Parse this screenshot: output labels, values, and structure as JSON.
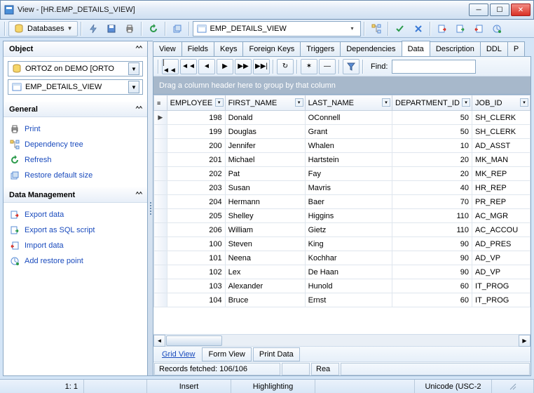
{
  "window": {
    "title": "View - [HR.EMP_DETAILS_VIEW]"
  },
  "toolbar": {
    "databases_label": "Databases",
    "breadcrumb": "EMP_DETAILS_VIEW"
  },
  "sidebar": {
    "object_header": "Object",
    "combo1": "ORTOZ on DEMO [ORTO",
    "combo2": "EMP_DETAILS_VIEW",
    "general_header": "General",
    "general_links": [
      "Print",
      "Dependency tree",
      "Refresh",
      "Restore default size"
    ],
    "datamgmt_header": "Data Management",
    "datamgmt_links": [
      "Export data",
      "Export as SQL script",
      "Import data",
      "Add restore point"
    ]
  },
  "tabs": [
    "View",
    "Fields",
    "Keys",
    "Foreign Keys",
    "Triggers",
    "Dependencies",
    "Data",
    "Description",
    "DDL",
    "P"
  ],
  "active_tab": "Data",
  "find_label": "Find:",
  "group_hint": "Drag a column header here to group by that column",
  "columns": [
    "EMPLOYEE",
    "FIRST_NAME",
    "LAST_NAME",
    "DEPARTMENT_ID",
    "JOB_ID"
  ],
  "rows": [
    {
      "emp": 198,
      "fn": "Donald",
      "ln": "OConnell",
      "dep": 50,
      "job": "SH_CLERK",
      "cur": true
    },
    {
      "emp": 199,
      "fn": "Douglas",
      "ln": "Grant",
      "dep": 50,
      "job": "SH_CLERK"
    },
    {
      "emp": 200,
      "fn": "Jennifer",
      "ln": "Whalen",
      "dep": 10,
      "job": "AD_ASST"
    },
    {
      "emp": 201,
      "fn": "Michael",
      "ln": "Hartstein",
      "dep": 20,
      "job": "MK_MAN"
    },
    {
      "emp": 202,
      "fn": "Pat",
      "ln": "Fay",
      "dep": 20,
      "job": "MK_REP"
    },
    {
      "emp": 203,
      "fn": "Susan",
      "ln": "Mavris",
      "dep": 40,
      "job": "HR_REP"
    },
    {
      "emp": 204,
      "fn": "Hermann",
      "ln": "Baer",
      "dep": 70,
      "job": "PR_REP"
    },
    {
      "emp": 205,
      "fn": "Shelley",
      "ln": "Higgins",
      "dep": 110,
      "job": "AC_MGR"
    },
    {
      "emp": 206,
      "fn": "William",
      "ln": "Gietz",
      "dep": 110,
      "job": "AC_ACCOU"
    },
    {
      "emp": 100,
      "fn": "Steven",
      "ln": "King",
      "dep": 90,
      "job": "AD_PRES"
    },
    {
      "emp": 101,
      "fn": "Neena",
      "ln": "Kochhar",
      "dep": 90,
      "job": "AD_VP"
    },
    {
      "emp": 102,
      "fn": "Lex",
      "ln": "De Haan",
      "dep": 90,
      "job": "AD_VP"
    },
    {
      "emp": 103,
      "fn": "Alexander",
      "ln": "Hunold",
      "dep": 60,
      "job": "IT_PROG"
    },
    {
      "emp": 104,
      "fn": "Bruce",
      "ln": "Ernst",
      "dep": 60,
      "job": "IT_PROG"
    }
  ],
  "bottom_tabs": {
    "grid": "Grid View",
    "form": "Form View",
    "print": "Print Data"
  },
  "status2": {
    "records": "Records fetched: 106/106",
    "rea": "Rea"
  },
  "winstatus": {
    "pos": "1: 1",
    "mode": "Insert",
    "highlight": "Highlighting",
    "enc": "Unicode (USC-2"
  }
}
